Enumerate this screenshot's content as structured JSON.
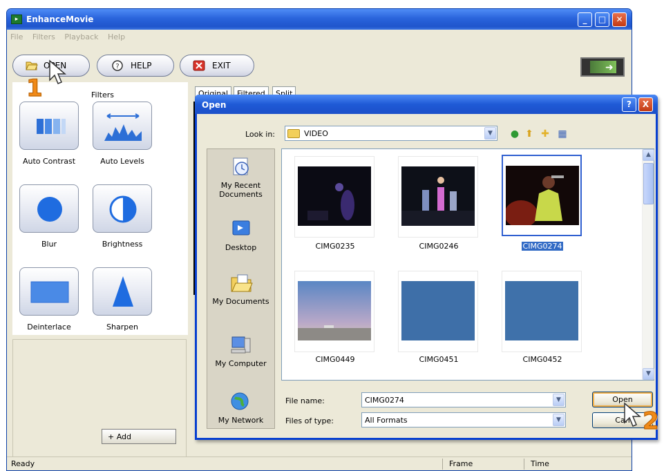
{
  "window": {
    "title": "EnhanceMovie",
    "menu": [
      "File",
      "Filters",
      "Playback",
      "Help"
    ],
    "toolbar": {
      "open": "OPEN",
      "help": "HELP",
      "exit": "EXIT"
    }
  },
  "filters": {
    "title": "Filters",
    "items": [
      {
        "label": "Auto Contrast",
        "icon": "auto-contrast-icon"
      },
      {
        "label": "Auto Levels",
        "icon": "auto-levels-icon"
      },
      {
        "label": "Blur",
        "icon": "blur-icon"
      },
      {
        "label": "Brightness",
        "icon": "brightness-icon"
      },
      {
        "label": "Deinterlace",
        "icon": "deinterlace-icon"
      },
      {
        "label": "Sharpen",
        "icon": "sharpen-icon"
      }
    ],
    "add": "+ Add"
  },
  "view_tabs": [
    "Original",
    "Filtered",
    "Split"
  ],
  "status": {
    "text": "Ready",
    "frame": "Frame",
    "time": "Time"
  },
  "dialog": {
    "title": "Open",
    "help_btn": "?",
    "close_btn": "X",
    "look_in_label": "Look in:",
    "look_in_value": "VIDEO",
    "places": [
      {
        "label": "My Recent Documents"
      },
      {
        "label": "Desktop"
      },
      {
        "label": "My Documents"
      },
      {
        "label": "My Computer"
      },
      {
        "label": "My Network"
      }
    ],
    "files": [
      {
        "name": "CIMG0235",
        "selected": false
      },
      {
        "name": "CIMG0246",
        "selected": false
      },
      {
        "name": "CIMG0274",
        "selected": true
      },
      {
        "name": "CIMG0449",
        "selected": false
      },
      {
        "name": "CIMG0451",
        "selected": false
      },
      {
        "name": "CIMG0452",
        "selected": false
      }
    ],
    "file_name_label": "File name:",
    "file_name_value": "CIMG0274",
    "file_type_label": "Files of type:",
    "file_type_value": "All Formats",
    "open_btn": "Open",
    "cancel_btn": "Can"
  },
  "steps": [
    "1",
    "2"
  ]
}
